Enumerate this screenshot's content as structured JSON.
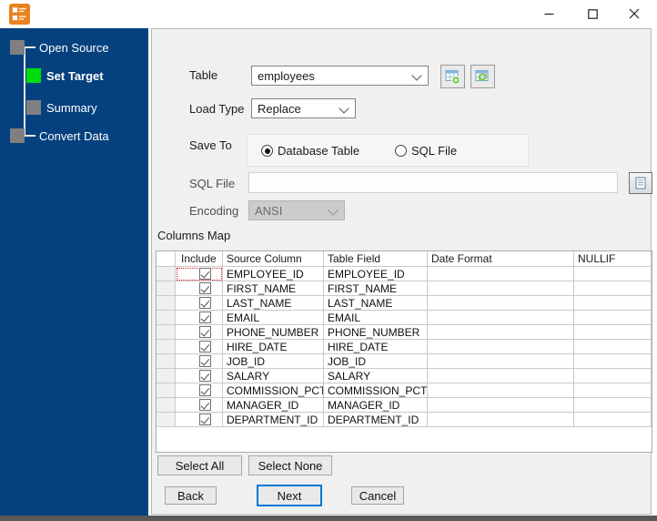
{
  "window": {
    "app_icon": "database-convert-tool",
    "controls": [
      {
        "name": "minimize"
      },
      {
        "name": "maximize"
      },
      {
        "name": "close"
      }
    ]
  },
  "sidebar": {
    "steps": [
      {
        "label": "Open Source",
        "state": "completed"
      },
      {
        "label": "Set Target",
        "state": "active"
      },
      {
        "label": "Summary",
        "state": "upcoming"
      },
      {
        "label": "Convert Data",
        "state": "upcoming"
      }
    ]
  },
  "form": {
    "table": {
      "label": "Table",
      "value": "employees"
    },
    "load_type": {
      "label": "Load Type",
      "value": "Replace"
    },
    "save_to": {
      "label": "Save To",
      "options": [
        {
          "label": "Database Table",
          "selected": true
        },
        {
          "label": "SQL File",
          "selected": false
        }
      ]
    },
    "sql_file": {
      "label": "SQL File",
      "value": "",
      "disabled": true
    },
    "encoding": {
      "label": "Encoding",
      "value": "ANSI",
      "disabled": true
    },
    "columns_map_label": "Columns Map"
  },
  "grid": {
    "columns": [
      "Include",
      "Source Column",
      "Table Field",
      "Date Format",
      "NULLIF"
    ],
    "focused_cell": {
      "row": 0,
      "column": "Include"
    },
    "rows": [
      {
        "include": true,
        "source": "EMPLOYEE_ID",
        "field": "EMPLOYEE_ID",
        "date_format": "",
        "nullif": ""
      },
      {
        "include": true,
        "source": "FIRST_NAME",
        "field": "FIRST_NAME",
        "date_format": "",
        "nullif": ""
      },
      {
        "include": true,
        "source": "LAST_NAME",
        "field": "LAST_NAME",
        "date_format": "",
        "nullif": ""
      },
      {
        "include": true,
        "source": "EMAIL",
        "field": "EMAIL",
        "date_format": "",
        "nullif": ""
      },
      {
        "include": true,
        "source": "PHONE_NUMBER",
        "field": "PHONE_NUMBER",
        "date_format": "",
        "nullif": ""
      },
      {
        "include": true,
        "source": "HIRE_DATE",
        "field": "HIRE_DATE",
        "date_format": "",
        "nullif": ""
      },
      {
        "include": true,
        "source": "JOB_ID",
        "field": "JOB_ID",
        "date_format": "",
        "nullif": ""
      },
      {
        "include": true,
        "source": "SALARY",
        "field": "SALARY",
        "date_format": "",
        "nullif": ""
      },
      {
        "include": true,
        "source": "COMMISSION_PCT",
        "field": "COMMISSION_PCT",
        "date_format": "",
        "nullif": ""
      },
      {
        "include": true,
        "source": "MANAGER_ID",
        "field": "MANAGER_ID",
        "date_format": "",
        "nullif": ""
      },
      {
        "include": true,
        "source": "DEPARTMENT_ID",
        "field": "DEPARTMENT_ID",
        "date_format": "",
        "nullif": ""
      }
    ]
  },
  "actions": {
    "select_all": "Select All",
    "select_none": "Select None",
    "back": "Back",
    "next": "Next",
    "cancel": "Cancel"
  },
  "colors": {
    "sidebar_bg": "#05417f",
    "step_active": "#00dd0c",
    "step_inactive": "#808080",
    "accent_blue": "#0078d7",
    "panel_bg": "#f0f0f0",
    "focus_dotted": "#cc2222",
    "app_icon_orange": "#e8821e"
  }
}
